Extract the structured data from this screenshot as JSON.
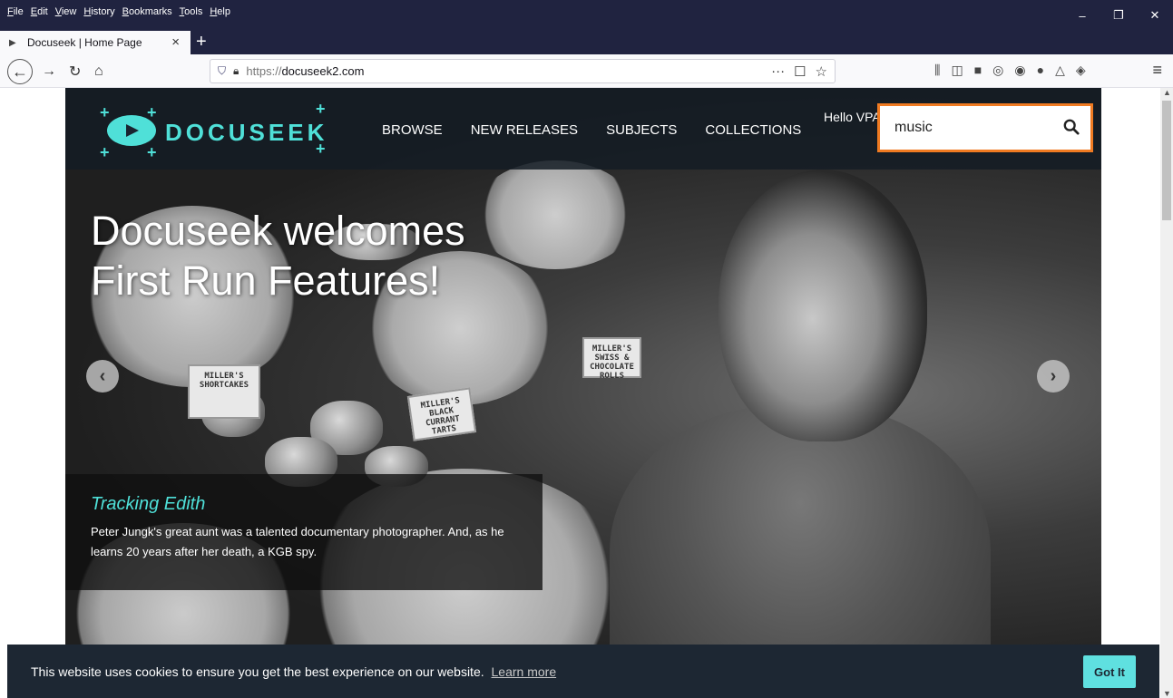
{
  "browser": {
    "menu": [
      "File",
      "Edit",
      "View",
      "History",
      "Bookmarks",
      "Tools",
      "Help"
    ],
    "tab_title": "Docuseek | Home Page",
    "url_scheme": "https://",
    "url_host": "docuseek2.com",
    "window_controls": {
      "minimize": "–",
      "restore": "❐",
      "close": "✕"
    }
  },
  "site": {
    "logo_text": "DOCUSEEK",
    "nav": [
      "BROWSE",
      "NEW RELEASES",
      "SUBJECTS",
      "COLLECTIONS"
    ],
    "greeting": "Hello VPA",
    "search_value": "music"
  },
  "hero": {
    "title_line1": "Docuseek welcomes",
    "title_line2": "First Run Features!",
    "caption_title": "Tracking Edith",
    "caption_text": "Peter Jungk's great aunt was a talented documentary photographer. And, as he learns 20 years after her death, a KGB spy.",
    "signs": [
      "MILLER'S SHORTCAKES",
      "MILLER'S BLACK CURRANT TARTS",
      "MILLER'S SWISS & CHOCOLATE ROLLS"
    ]
  },
  "cookie": {
    "message": "This website uses cookies to ensure you get the best experience on our website.",
    "link": "Learn more",
    "button": "Got It"
  },
  "colors": {
    "accent": "#4fe0d8",
    "search_highlight": "#f07b22",
    "chrome_dark": "#202340",
    "cookie_bg": "#1d2733"
  }
}
